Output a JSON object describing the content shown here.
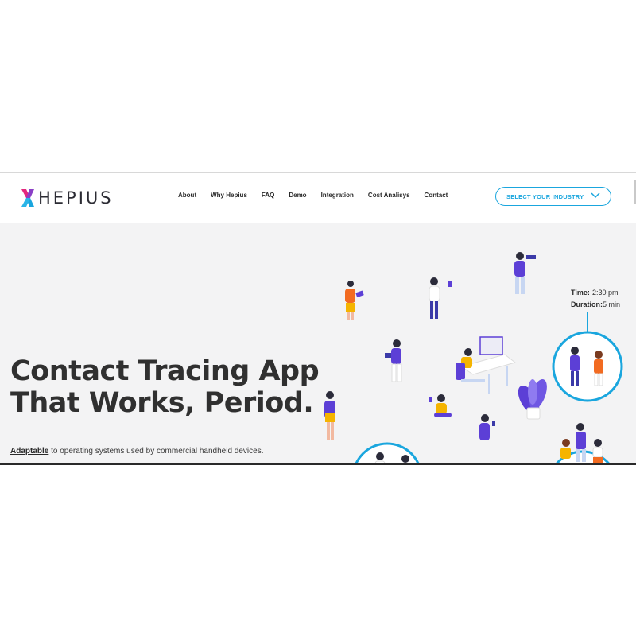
{
  "brand": {
    "name": "HEPIUS",
    "accent_pink": "#e4277d",
    "accent_blue": "#1aa6de"
  },
  "nav": {
    "items": [
      "About",
      "Why Hepius",
      "FAQ",
      "Demo",
      "Integration",
      "Cost Analisys",
      "Contact"
    ],
    "industry_button": "SELECT YOUR INDUSTRY"
  },
  "hero": {
    "headline_line1": "Contact Tracing App",
    "headline_line2": "That Works, Period.",
    "sub_highlight": "Adaptable",
    "sub_rest": " to operating systems used by commercial handheld devices.",
    "meeting_card": {
      "time_label": "Time:",
      "time_value": "2:30 pm",
      "duration_label": "Duration:",
      "duration_value": "5 min"
    }
  }
}
